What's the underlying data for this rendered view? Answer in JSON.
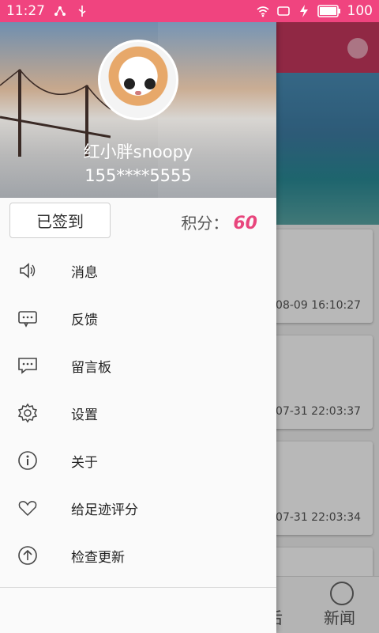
{
  "status_bar": {
    "time": "11:27",
    "battery": "100"
  },
  "drawer": {
    "username": "红小胖snoopy",
    "phone": "155****5555",
    "checkin_label": "已签到",
    "points_label": "积分：",
    "points_value": "60",
    "menu": [
      {
        "label": "消息",
        "icon": "speaker-icon"
      },
      {
        "label": "反馈",
        "icon": "chat-bubble-icon"
      },
      {
        "label": "留言板",
        "icon": "message-board-icon"
      },
      {
        "label": "设置",
        "icon": "gear-icon"
      },
      {
        "label": "关于",
        "icon": "info-icon"
      },
      {
        "label": "给足迹评分",
        "icon": "heart-icon"
      },
      {
        "label": "检查更新",
        "icon": "arrow-up-circle-icon"
      }
    ]
  },
  "background": {
    "cards": [
      {
        "time": "-08-09 16:10:27"
      },
      {
        "time": "-07-31 22:03:37"
      },
      {
        "time": "-07-31 22:03:34"
      }
    ],
    "nav": {
      "partial_label": "后",
      "news_label": "新闻"
    }
  },
  "colors": {
    "accent": "#f0447f",
    "points": "#e8457c"
  }
}
